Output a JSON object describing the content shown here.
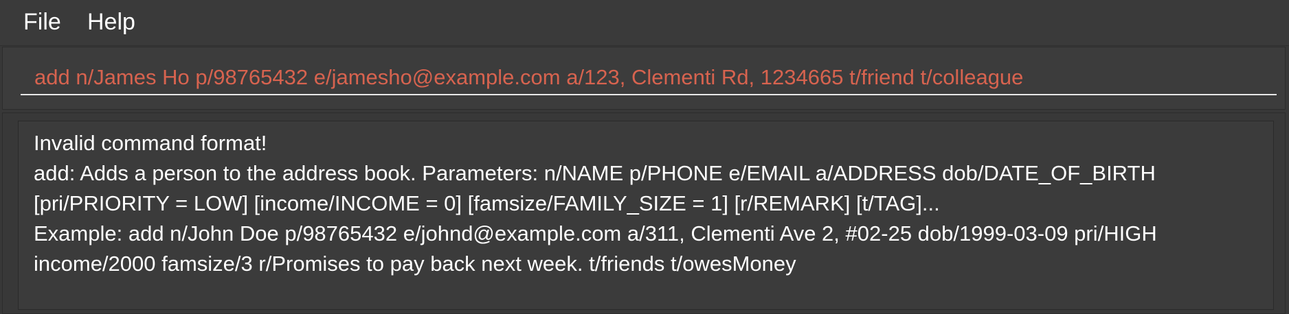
{
  "menubar": {
    "file_label": "File",
    "help_label": "Help"
  },
  "command_box": {
    "value": "add n/James Ho p/98765432 e/jamesho@example.com a/123, Clementi Rd, 1234665 t/friend t/colleague",
    "text_color": "#d7634f"
  },
  "result_display": {
    "lines": [
      "Invalid command format!",
      "add: Adds a person to the address book. Parameters: n/NAME p/PHONE e/EMAIL a/ADDRESS dob/DATE_OF_BIRTH",
      "[pri/PRIORITY = LOW] [income/INCOME = 0] [famsize/FAMILY_SIZE = 1] [r/REMARK] [t/TAG]...",
      "Example: add n/John Doe p/98765432 e/johnd@example.com a/311, Clementi Ave 2, #02-25 dob/1999-03-09 pri/HIGH",
      "income/2000 famsize/3 r/Promises to pay back next week. t/friends t/owesMoney"
    ]
  },
  "colors": {
    "background": "#383838",
    "error_text": "#d7634f",
    "text": "#ffffff"
  }
}
